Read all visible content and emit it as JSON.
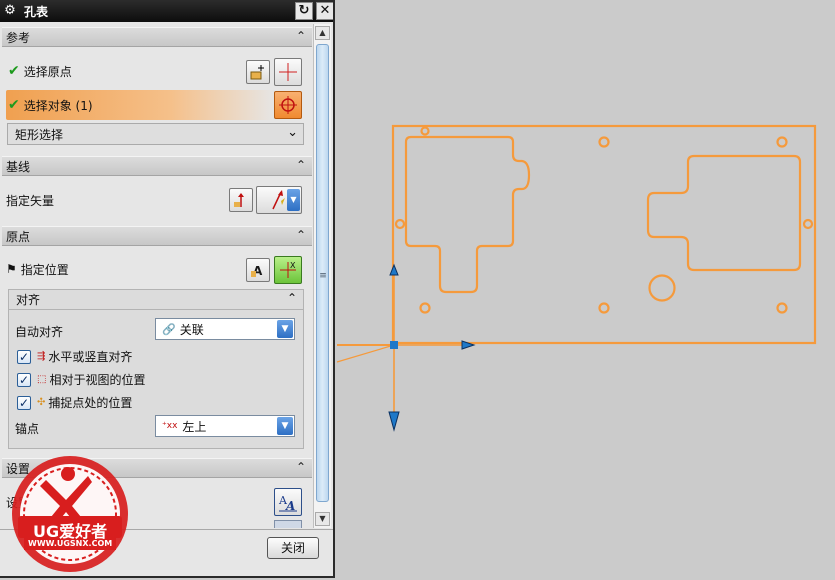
{
  "dialog": {
    "title": "孔表",
    "reset_icon": "reset-icon",
    "close_icon": "close-icon"
  },
  "sections": {
    "reference": {
      "header": "参考",
      "specify_origin": "选择原点",
      "select_object": "选择对象 (1)",
      "rect_select": "矩形选择"
    },
    "baseline": {
      "header": "基线",
      "specify_vector": "指定矢量"
    },
    "origin": {
      "header": "原点",
      "specify_location": "指定位置",
      "alignment": {
        "header": "对齐",
        "auto_align_label": "自动对齐",
        "auto_align_value": "关联",
        "opt_hv": "水平或竖直对齐",
        "opt_view": "相对于视图的位置",
        "opt_snap": "捕捉点处的位置",
        "anchor_label": "锚点",
        "anchor_value": "左上"
      }
    },
    "settings": {
      "header": "设置",
      "settings_label": "设置"
    }
  },
  "footer": {
    "close": "关闭"
  },
  "watermark": {
    "brand": "UG爱好者",
    "url": "WWW.UGSNX.COM"
  },
  "colors": {
    "geometry": "#f59a3c",
    "highlight": "#f0a050",
    "axis": "#1e78c8"
  }
}
